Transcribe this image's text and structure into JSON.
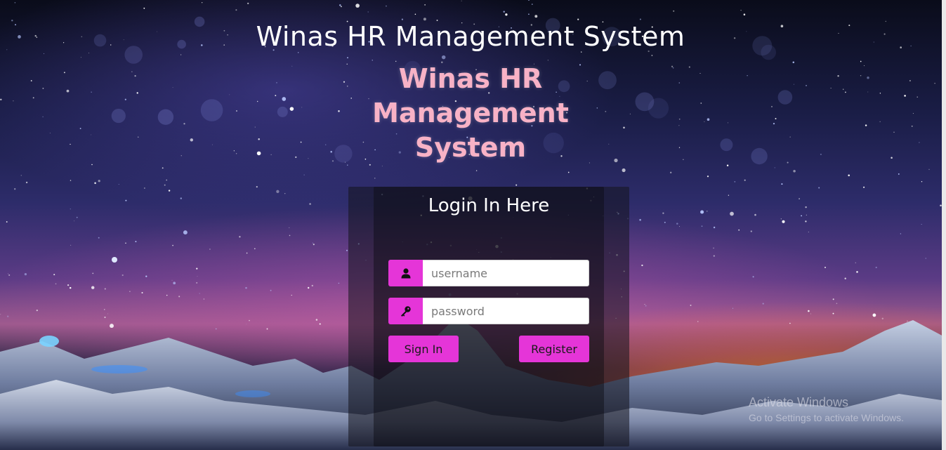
{
  "header": {
    "title": "Winas HR Management System",
    "subtitle_lines": [
      "Winas HR",
      "Management",
      "System"
    ]
  },
  "login": {
    "heading": "Login In Here",
    "username_placeholder": "username",
    "password_placeholder": "password",
    "username_icon": "user-icon",
    "password_icon": "key-icon",
    "sign_in_label": "Sign In",
    "register_label": "Register"
  },
  "watermark": {
    "line1": "Activate Windows",
    "line2": "Go to Settings to activate Windows."
  },
  "colors": {
    "accent": "#e535d8",
    "subtitle": "#f8b2c6",
    "text": "#ffffff"
  }
}
